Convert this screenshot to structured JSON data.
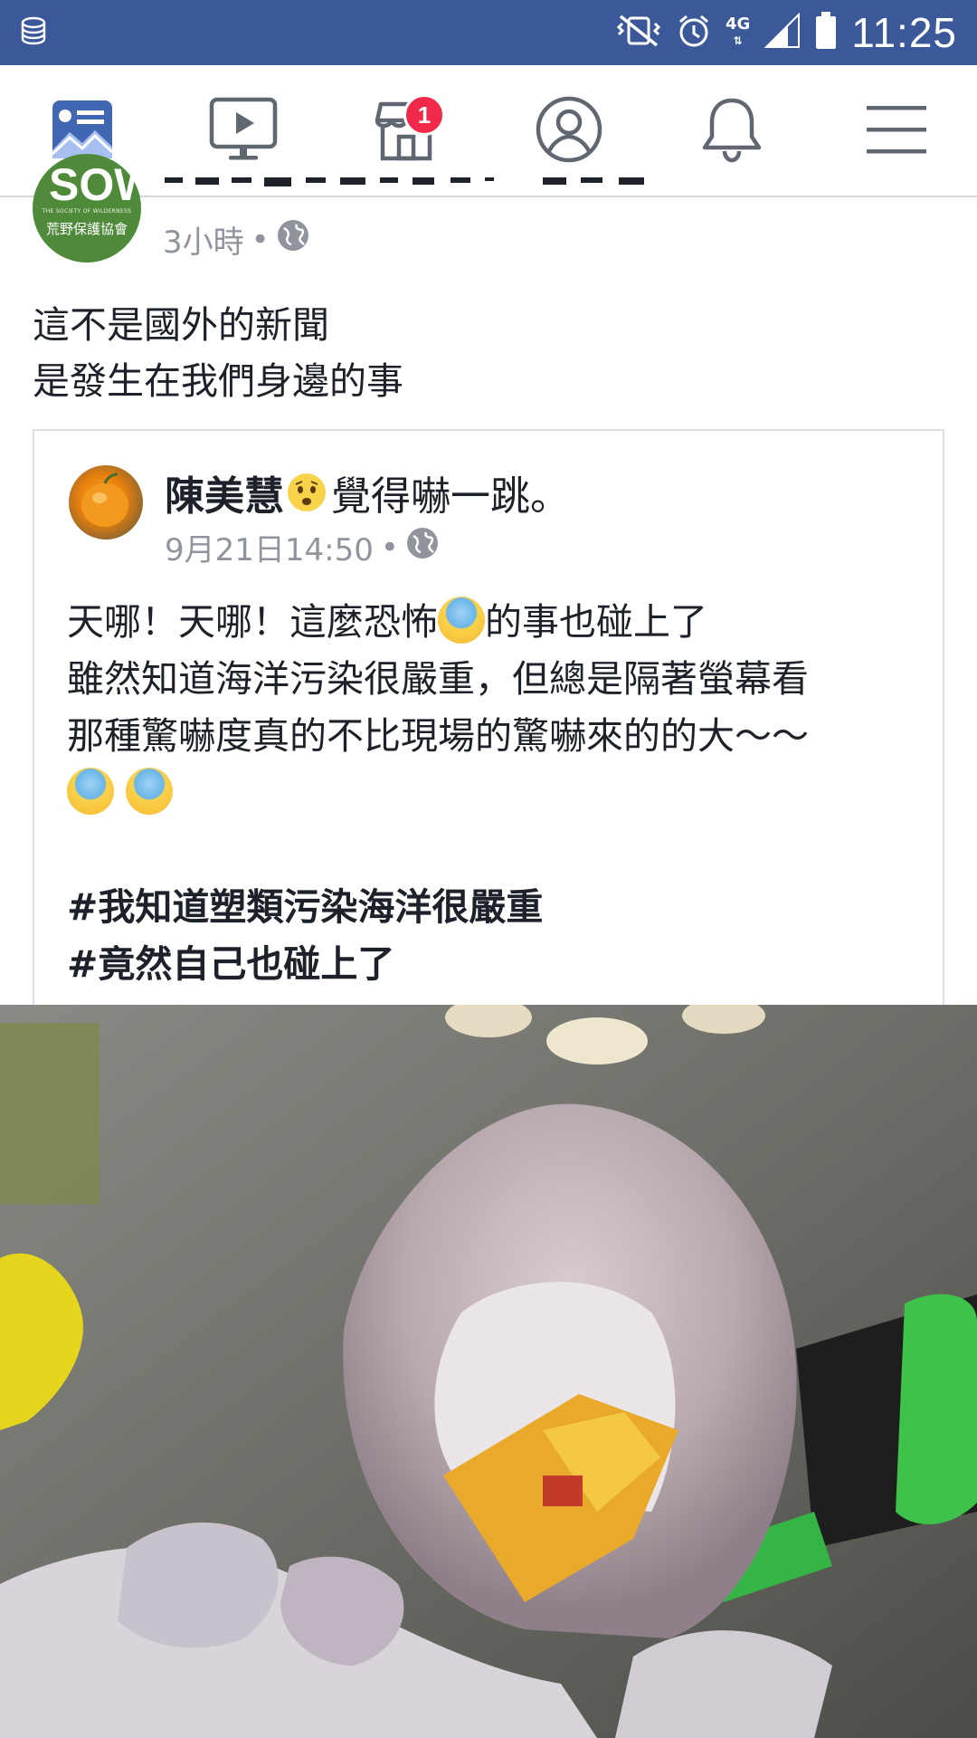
{
  "status_bar": {
    "time": "11:25",
    "network": "4G",
    "icons": [
      "storage-icon",
      "vibrate-mute-icon",
      "alarm-icon",
      "signal-icon",
      "battery-icon"
    ]
  },
  "nav": {
    "items": [
      {
        "name": "news-feed",
        "icon": "news-feed-icon",
        "active": true
      },
      {
        "name": "watch",
        "icon": "video-play-icon"
      },
      {
        "name": "marketplace",
        "icon": "marketplace-icon",
        "badge": "1"
      },
      {
        "name": "profile",
        "icon": "profile-icon"
      },
      {
        "name": "notifications",
        "icon": "bell-icon"
      },
      {
        "name": "menu",
        "icon": "hamburger-menu-icon"
      }
    ],
    "badge_color": "#f02849",
    "active_color": "#4267b2"
  },
  "post": {
    "org_avatar": {
      "mark": "SOW",
      "sub": "THE SOCIETY OF WILDERNESS",
      "name": "荒野保護協會"
    },
    "time": "3小時",
    "separator": "•",
    "privacy_icon": "globe-icon",
    "text_lines": [
      "這不是國外的新聞",
      "是發生在我們身邊的事"
    ]
  },
  "shared_post": {
    "author": "陳美慧",
    "feeling": "覺得嚇一跳。",
    "time": "9月21日14:50",
    "separator": "•",
    "privacy_icon": "globe-icon",
    "body": {
      "line1_a": "天哪！天哪！這麼恐怖",
      "line1_b": "的事也碰上了",
      "line2": "雖然知道海洋污染很嚴重，但總是隔著螢幕看",
      "line3": "那種驚嚇度真的不比現場的驚嚇來的的大～～",
      "hashtags": [
        "#我知道塑類污染海洋很嚴重",
        "#竟然自己也碰上了"
      ]
    },
    "photo_icon": "photo-squid-with-plastic"
  },
  "colors": {
    "status_bar": "#3b5998",
    "text": "#1d2129",
    "meta": "#90949c"
  }
}
